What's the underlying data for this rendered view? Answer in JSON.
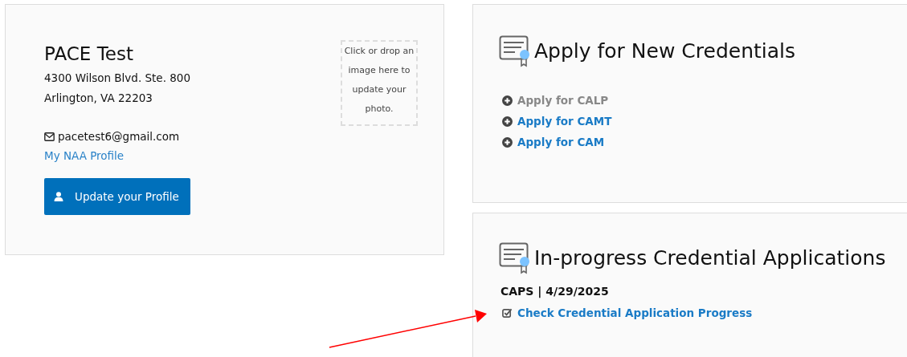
{
  "profile": {
    "name": "PACE Test",
    "address_lines": [
      "4300 Wilson Blvd. Ste. 800",
      "Arlington, VA 22203"
    ],
    "email": "pacetest6@gmail.com",
    "profile_link": "My NAA Profile",
    "update_button": "Update your Profile",
    "photo_drop": "Click or drop an image here to update your photo."
  },
  "apply": {
    "title": "Apply for New Credentials",
    "items": [
      {
        "label": "Apply for CALP",
        "disabled": true
      },
      {
        "label": "Apply for CAMT",
        "disabled": false
      },
      {
        "label": "Apply for CAM",
        "disabled": false
      }
    ]
  },
  "in_progress": {
    "title": "In-progress Credential Applications",
    "applications": [
      {
        "heading": "CAPS | 4/29/2025",
        "link": "Check Credential Application Progress"
      }
    ]
  }
}
